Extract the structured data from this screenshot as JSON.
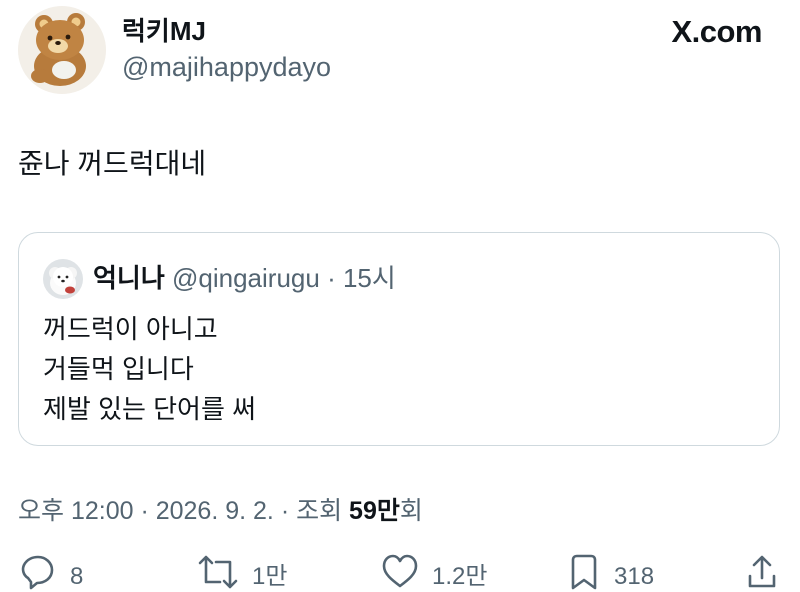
{
  "author": {
    "display_name": "럭키MJ",
    "handle": "@majihappydayo",
    "avatar_icon": "bear-avatar-icon"
  },
  "site_label": "X.com",
  "tweet": {
    "text": "쥰나 꺼드럭대네"
  },
  "quote": {
    "display_name": "억니나",
    "handle": "@qingairugu",
    "separator": "·",
    "time": "15시",
    "avatar_icon": "puppy-avatar-icon",
    "lines": [
      "꺼드럭이 아니고",
      "거들먹 입니다",
      "제발 있는 단어를 써"
    ]
  },
  "meta": {
    "datetime": "오후 12:00 · 2026. 9. 2. · 조회 ",
    "views_count": "59만",
    "views_suffix": "회"
  },
  "actions": {
    "reply": {
      "icon": "reply-icon",
      "count": "8"
    },
    "retweet": {
      "icon": "retweet-icon",
      "count": "1만"
    },
    "like": {
      "icon": "heart-icon",
      "count": "1.2만"
    },
    "bookmark": {
      "icon": "bookmark-icon",
      "count": "318"
    },
    "share": {
      "icon": "share-icon"
    }
  },
  "colors": {
    "text_primary": "#0f1419",
    "text_secondary": "#536471",
    "card_border": "#cfd9de",
    "background": "#ffffff"
  }
}
